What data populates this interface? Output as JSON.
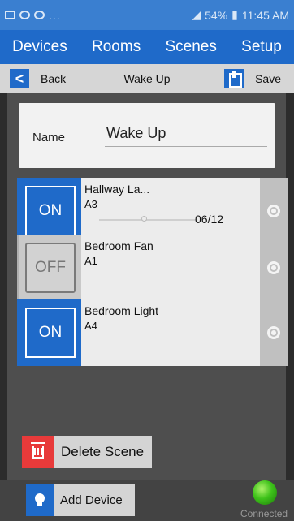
{
  "statusbar": {
    "dots": "...",
    "battery": "54%",
    "time": "11:45 AM"
  },
  "tabs": [
    {
      "label": "Devices"
    },
    {
      "label": "Rooms"
    },
    {
      "label": "Scenes"
    },
    {
      "label": "Setup"
    }
  ],
  "toolbar": {
    "back_icon": "<",
    "back_label": "Back",
    "title": "Wake Up",
    "save_label": "Save"
  },
  "name_field": {
    "label": "Name",
    "value": "Wake Up"
  },
  "devices": [
    {
      "state": "ON",
      "name": "Hallway La...",
      "address": "A3",
      "level": "06/12",
      "level_fraction": 0.5
    },
    {
      "state": "OFF",
      "name": "Bedroom Fan",
      "address": "A1"
    },
    {
      "state": "ON",
      "name": "Bedroom Light",
      "address": "A4"
    }
  ],
  "delete_label": "Delete Scene",
  "add_device_label": "Add Device",
  "connection_status": "Connected",
  "colors": {
    "accent": "#1f6ac9",
    "delete": "#e83a3a",
    "connected": "#3ec21a"
  }
}
